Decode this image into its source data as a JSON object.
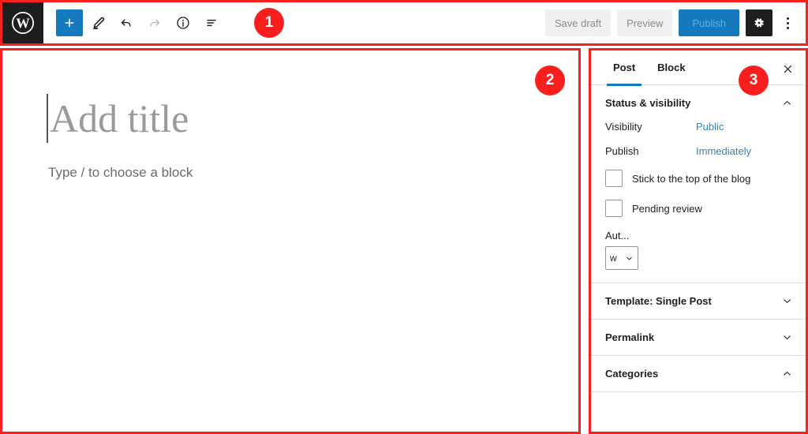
{
  "app": {
    "name": "WordPress Block Editor",
    "logo_icon": "wordpress-logo-icon"
  },
  "toolbar": {
    "add_block_label": "+",
    "add_block_icon": "plus-icon",
    "tools_icon": "pencil-icon",
    "undo_icon": "undo-arrow-icon",
    "redo_icon": "redo-arrow-icon",
    "details_icon": "info-circle-icon",
    "list_view_icon": "list-view-icon",
    "save_draft_label": "Save draft",
    "preview_label": "Preview",
    "publish_label": "Publish",
    "settings_icon": "gear-icon",
    "options_icon": "three-dots-vertical-icon"
  },
  "canvas": {
    "title_placeholder": "Add title",
    "block_placeholder": "Type / to choose a block"
  },
  "sidebar": {
    "tabs": [
      {
        "label": "Post",
        "active": true
      },
      {
        "label": "Block",
        "active": false
      }
    ],
    "close_icon": "close-x-icon",
    "panels": [
      {
        "title": "Status & visibility",
        "expanded": true,
        "chevron": "chevron-up-icon"
      },
      {
        "title": "Template: Single Post",
        "expanded": false,
        "chevron": "chevron-down-icon"
      },
      {
        "title": "Permalink",
        "expanded": false,
        "chevron": "chevron-down-icon"
      },
      {
        "title": "Categories",
        "expanded": true,
        "chevron": "chevron-up-icon"
      }
    ],
    "status": {
      "visibility_label": "Visibility",
      "visibility_value": "Public",
      "publish_label": "Publish",
      "publish_value": "Immediately",
      "sticky_label": "Stick to the top of the blog",
      "pending_label": "Pending review",
      "author_label": "Aut...",
      "author_value": "w",
      "author_chevron": "chevron-down-icon"
    }
  },
  "annotations": {
    "badges": [
      {
        "number": "1",
        "target": "toolbar"
      },
      {
        "number": "2",
        "target": "editor-canvas"
      },
      {
        "number": "3",
        "target": "settings-sidebar"
      }
    ],
    "frame_color": "#fb2020"
  },
  "colors": {
    "accent_blue": "#1479bd",
    "link_blue": "#3c7fae",
    "dark": "#1e1e1e",
    "badge_red": "#fb1e1e"
  }
}
